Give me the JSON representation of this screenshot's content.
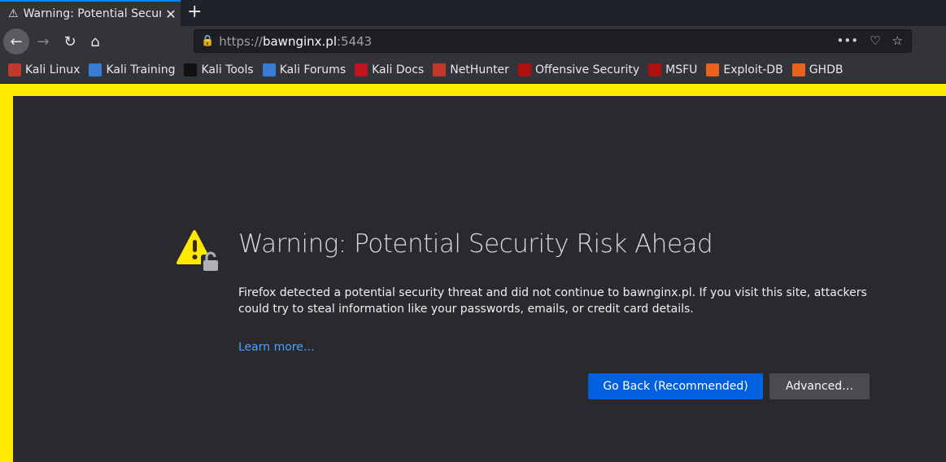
{
  "tab": {
    "title": "Warning: Potential Security Risk Ahead",
    "close": "✕",
    "new_tab": "+"
  },
  "url": {
    "scheme": "https://",
    "host": "bawnginx.pl",
    "port": ":5443"
  },
  "bookmarks": [
    {
      "label": "Kali Linux",
      "color": "#c0392b"
    },
    {
      "label": "Kali Training",
      "color": "#3a7bd5"
    },
    {
      "label": "Kali Tools",
      "color": "#111111"
    },
    {
      "label": "Kali Forums",
      "color": "#3a7bd5"
    },
    {
      "label": "Kali Docs",
      "color": "#c0141e"
    },
    {
      "label": "NetHunter",
      "color": "#c0392b"
    },
    {
      "label": "Offensive Security",
      "color": "#b01010"
    },
    {
      "label": "MSFU",
      "color": "#b01010"
    },
    {
      "label": "Exploit-DB",
      "color": "#e8641e"
    },
    {
      "label": "GHDB",
      "color": "#e8641e"
    }
  ],
  "page": {
    "title": "Warning: Potential Security Risk Ahead",
    "description": "Firefox detected a potential security threat and did not continue to bawnginx.pl. If you visit this site, attackers could try to steal information like your passwords, emails, or credit card details.",
    "learn_more": "Learn more…",
    "go_back": "Go Back (Recommended)",
    "advanced": "Advanced…"
  }
}
